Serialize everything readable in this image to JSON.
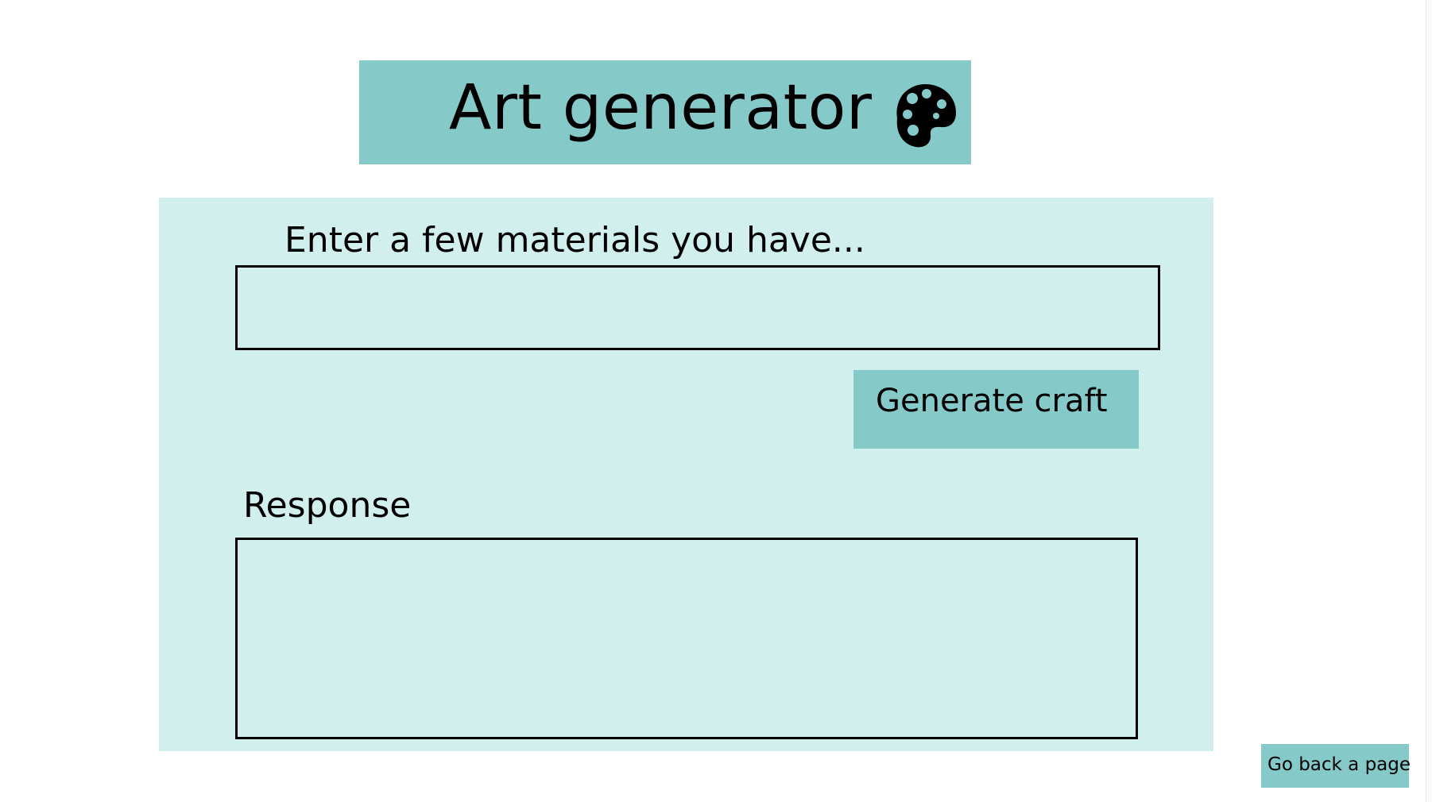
{
  "header": {
    "title": "Art generator",
    "icon": "palette-icon"
  },
  "form": {
    "materials_label": "Enter a few materials you have...",
    "materials_value": "",
    "generate_label": "Generate craft",
    "response_label": "Response",
    "response_value": ""
  },
  "footer": {
    "back_label": "Go back a page"
  },
  "colors": {
    "accent": "#86c9c9",
    "panel": "#d1efed",
    "text": "#000000"
  }
}
